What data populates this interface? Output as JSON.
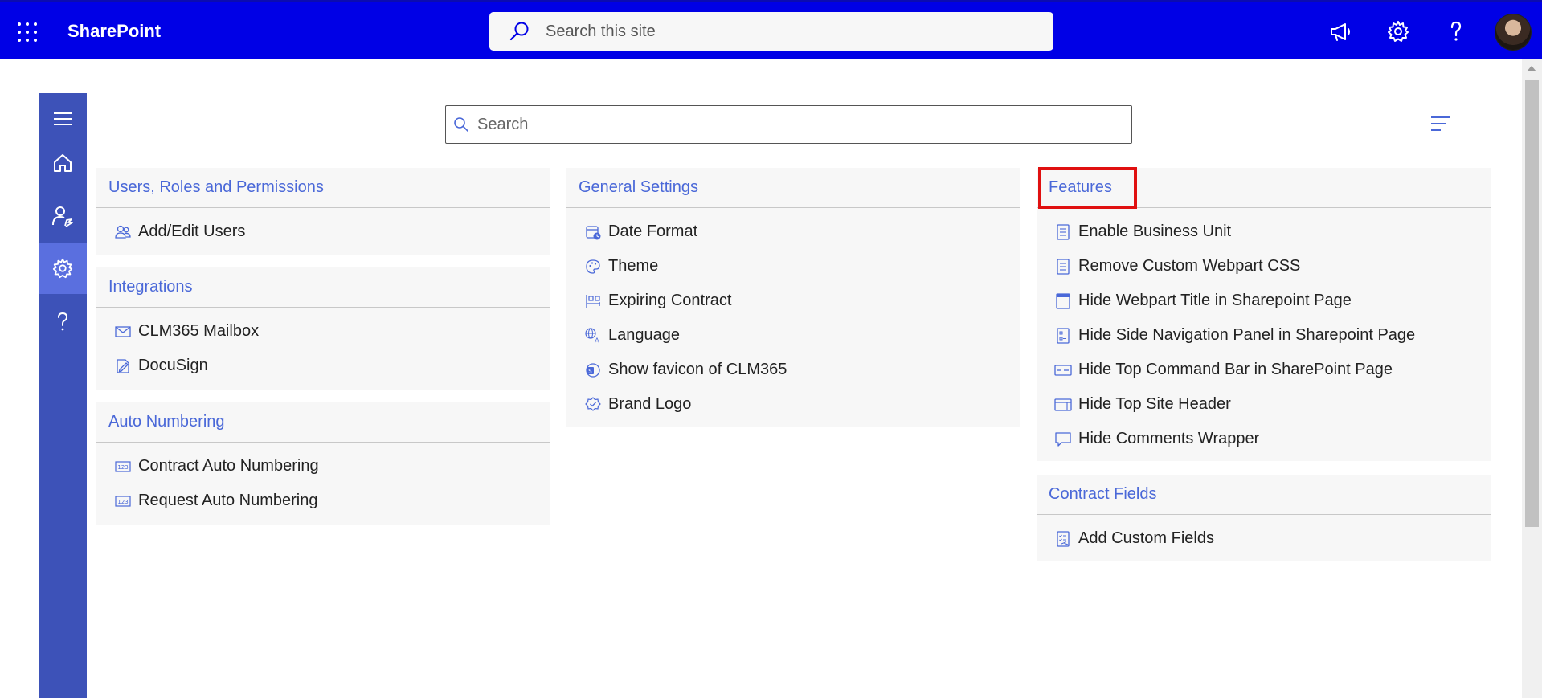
{
  "suitebar": {
    "brand": "SharePoint",
    "search_placeholder": "Search this site",
    "icons": [
      "app-launcher-icon",
      "megaphone-icon",
      "gear-icon",
      "help-icon"
    ],
    "accent": "#0000e6"
  },
  "rail": {
    "items": [
      "menu-icon",
      "home-icon",
      "user-settings-icon",
      "gear-icon",
      "help-icon"
    ],
    "active": "gear-icon",
    "color": "#3d52b8"
  },
  "content_search": {
    "placeholder": "Search"
  },
  "sections": {
    "users": {
      "title": "Users, Roles and Permissions",
      "items": [
        {
          "label": "Add/Edit Users",
          "icon": "users-icon"
        }
      ]
    },
    "integrations": {
      "title": "Integrations",
      "items": [
        {
          "label": "CLM365 Mailbox",
          "icon": "mail-icon"
        },
        {
          "label": "DocuSign",
          "icon": "sign-icon"
        }
      ]
    },
    "auto_numbering": {
      "title": "Auto Numbering",
      "items": [
        {
          "label": "Contract Auto Numbering",
          "icon": "number-icon"
        },
        {
          "label": "Request Auto Numbering",
          "icon": "number-icon"
        }
      ]
    },
    "general": {
      "title": "General Settings",
      "items": [
        {
          "label": "Date Format",
          "icon": "calendar-clock-icon"
        },
        {
          "label": "Theme",
          "icon": "palette-icon"
        },
        {
          "label": "Expiring Contract",
          "icon": "timeline-icon"
        },
        {
          "label": "Language",
          "icon": "globe-translate-icon"
        },
        {
          "label": "Show favicon of CLM365",
          "icon": "favicon-icon"
        },
        {
          "label": "Brand Logo",
          "icon": "badge-icon"
        }
      ]
    },
    "features": {
      "title": "Features",
      "items": [
        {
          "label": "Enable Business Unit",
          "icon": "document-icon"
        },
        {
          "label": "Remove Custom Webpart CSS",
          "icon": "document-icon"
        },
        {
          "label": "Hide Webpart Title in Sharepoint Page",
          "icon": "webpart-icon"
        },
        {
          "label": "Hide Side Navigation Panel in Sharepoint Page",
          "icon": "side-nav-icon"
        },
        {
          "label": "Hide Top Command Bar in SharePoint Page",
          "icon": "command-bar-icon"
        },
        {
          "label": "Hide Top Site Header",
          "icon": "site-header-icon"
        },
        {
          "label": "Hide Comments Wrapper",
          "icon": "comment-icon"
        }
      ]
    },
    "contract_fields": {
      "title": "Contract Fields",
      "items": [
        {
          "label": "Add Custom Fields",
          "icon": "checklist-icon"
        }
      ]
    }
  },
  "colors": {
    "section_title": "#4a68d8",
    "card_bg": "#f7f7f7",
    "highlight": "#e01010"
  }
}
